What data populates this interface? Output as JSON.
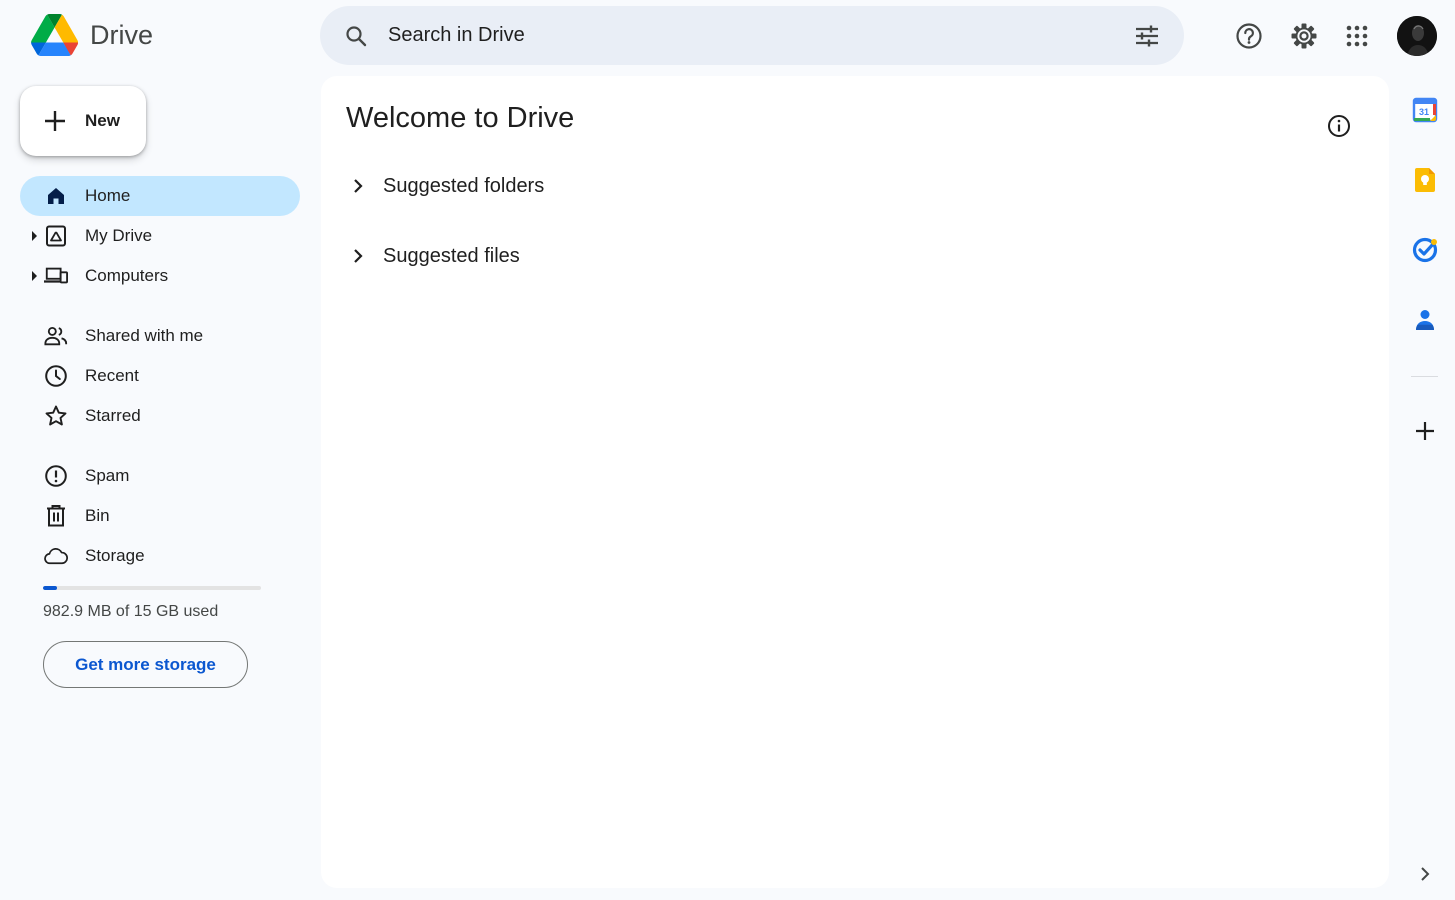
{
  "app": {
    "name": "Drive"
  },
  "search": {
    "placeholder": "Search in Drive"
  },
  "sidebar": {
    "new_label": "New",
    "items": [
      {
        "label": "Home",
        "icon": "home-icon",
        "active": true
      },
      {
        "label": "My Drive",
        "icon": "my-drive-icon",
        "expandable": true
      },
      {
        "label": "Computers",
        "icon": "computers-icon",
        "expandable": true
      },
      {
        "label": "Shared with me",
        "icon": "people-icon"
      },
      {
        "label": "Recent",
        "icon": "clock-icon"
      },
      {
        "label": "Starred",
        "icon": "star-icon"
      },
      {
        "label": "Spam",
        "icon": "spam-icon"
      },
      {
        "label": "Bin",
        "icon": "trash-icon"
      },
      {
        "label": "Storage",
        "icon": "cloud-icon"
      }
    ],
    "storage": {
      "used_text": "982.9 MB of 15 GB used",
      "used_fraction": 0.064
    },
    "get_storage_label": "Get more storage"
  },
  "main": {
    "title": "Welcome to Drive",
    "sections": [
      {
        "label": "Suggested folders"
      },
      {
        "label": "Suggested files"
      }
    ]
  },
  "right_rail": {
    "apps": [
      "calendar-icon",
      "keep-icon",
      "tasks-icon",
      "contacts-icon"
    ],
    "calendar_day": "31"
  },
  "colors": {
    "accent": "#0b57d0",
    "active_nav": "#c2e7ff",
    "search_bg": "#e9eef6",
    "page_bg": "#f8fafd"
  }
}
